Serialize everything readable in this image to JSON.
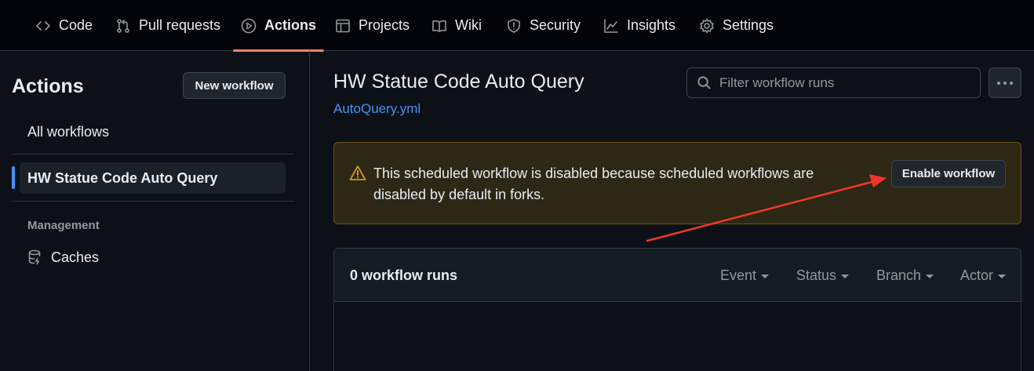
{
  "nav": {
    "tabs": [
      {
        "label": "Code",
        "icon": "code-icon"
      },
      {
        "label": "Pull requests",
        "icon": "pull-request-icon"
      },
      {
        "label": "Actions",
        "icon": "play-icon",
        "active": true
      },
      {
        "label": "Projects",
        "icon": "table-icon"
      },
      {
        "label": "Wiki",
        "icon": "book-icon"
      },
      {
        "label": "Security",
        "icon": "shield-icon"
      },
      {
        "label": "Insights",
        "icon": "graph-icon"
      },
      {
        "label": "Settings",
        "icon": "gear-icon"
      }
    ]
  },
  "sidebar": {
    "title": "Actions",
    "new_workflow_label": "New workflow",
    "items": [
      {
        "label": "All workflows"
      },
      {
        "label": "HW Statue Code Auto Query",
        "selected": true
      }
    ],
    "management_heading": "Management",
    "caches_label": "Caches"
  },
  "main": {
    "title": "HW Statue Code Auto Query",
    "file_link": "AutoQuery.yml",
    "search_placeholder": "Filter workflow runs",
    "warning": {
      "text": "This scheduled workflow is disabled because scheduled workflows are disabled by default in forks.",
      "button_label": "Enable workflow"
    },
    "runs": {
      "count_label": "0 workflow runs",
      "filters": [
        "Event",
        "Status",
        "Branch",
        "Actor"
      ]
    }
  },
  "colors": {
    "background": "#0d1117",
    "accent_underline": "#f78166",
    "link": "#4493f8",
    "warning_bg": "#2d2715",
    "warning_icon": "#d29922",
    "annotation_arrow": "#f0362c"
  }
}
